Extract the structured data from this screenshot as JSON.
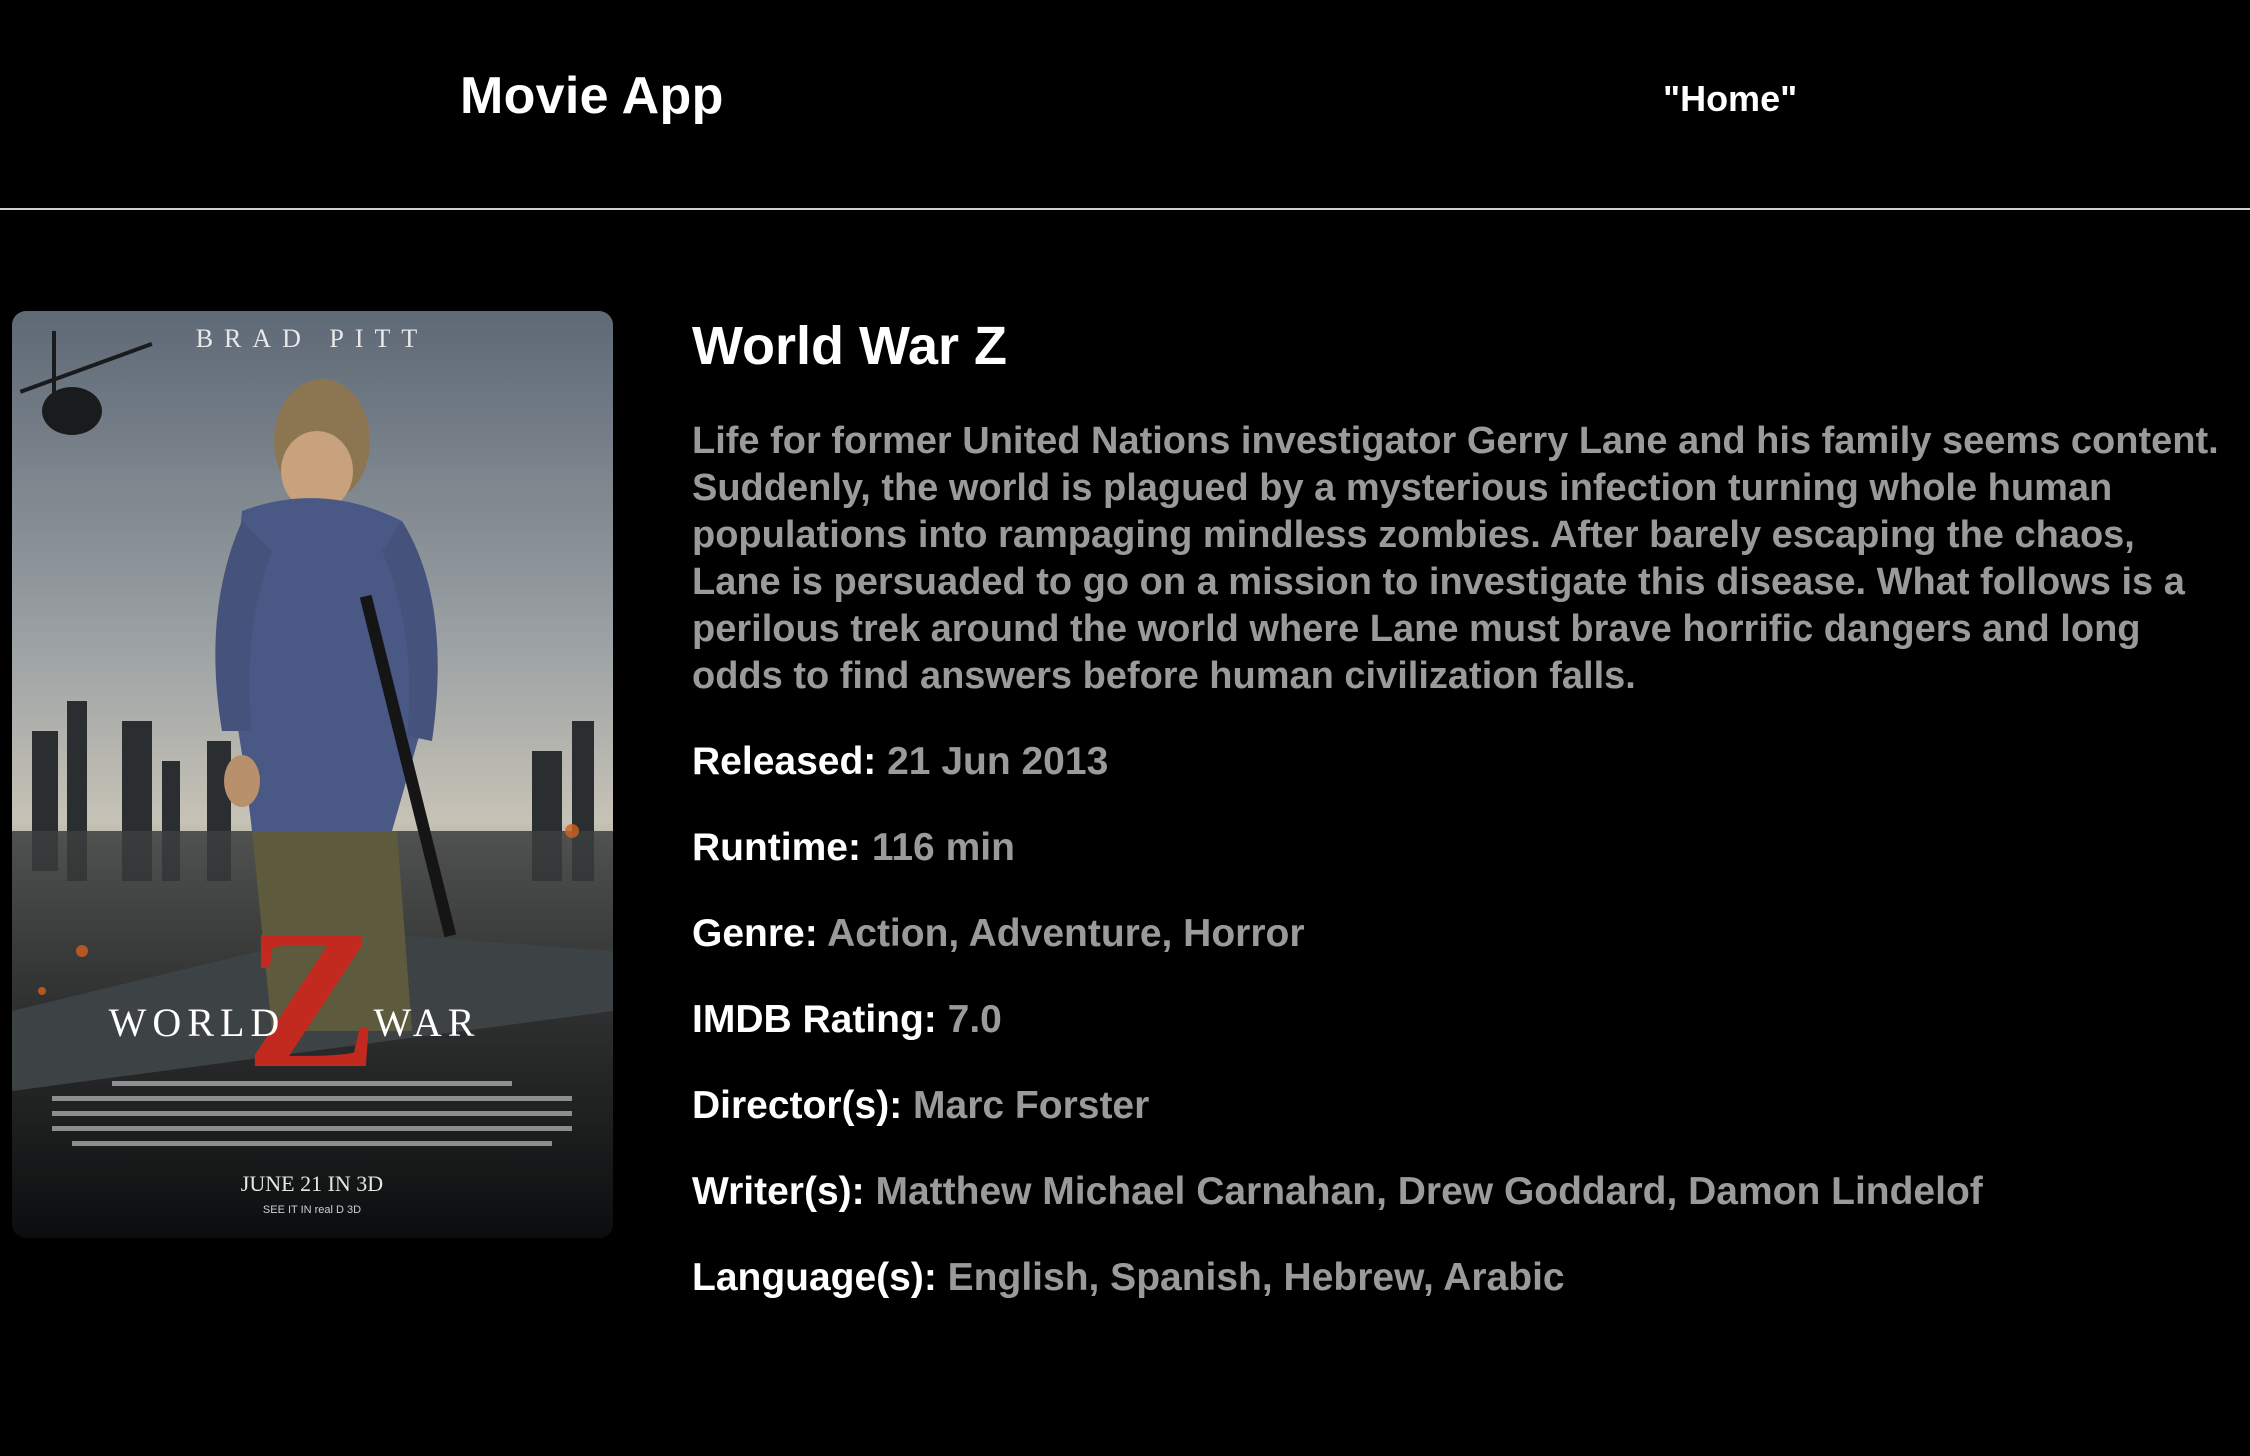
{
  "header": {
    "brand": "Movie App",
    "nav_home": "\"Home\""
  },
  "movie": {
    "title": "World War Z",
    "plot": "Life for former United Nations investigator Gerry Lane and his family seems content. Suddenly, the world is plagued by a mysterious infection turning whole human populations into rampaging mindless zombies. After barely escaping the chaos, Lane is persuaded to go on a mission to investigate this disease. What follows is a perilous trek around the world where Lane must brave horrific dangers and long odds to find answers before human civilization falls.",
    "fields": {
      "released": {
        "label": "Released:",
        "value": "21 Jun 2013"
      },
      "runtime": {
        "label": "Runtime:",
        "value": "116 min"
      },
      "genre": {
        "label": "Genre:",
        "value": "Action, Adventure, Horror"
      },
      "imdb": {
        "label": "IMDB Rating:",
        "value": "7.0"
      },
      "director": {
        "label": "Director(s):",
        "value": "Marc Forster"
      },
      "writer": {
        "label": "Writer(s):",
        "value": "Matthew Michael Carnahan, Drew Goddard, Damon Lindelof"
      },
      "language": {
        "label": "Language(s):",
        "value": "English, Spanish, Hebrew, Arabic"
      }
    }
  },
  "poster": {
    "actor": "BRAD PITT",
    "title_left": "WORLD",
    "title_right": "WAR",
    "title_z": "Z",
    "release_line": "JUNE 21 IN 3D",
    "see_line": "SEE IT IN real D 3D",
    "colors": {
      "sky_top": "#6f7a86",
      "sky_bottom": "#c9c6bd",
      "shirt": "#4a5886",
      "z_red": "#c2291f"
    }
  },
  "colors": {
    "background": "#000000",
    "text_primary": "#ffffff",
    "text_secondary": "#9a9a9a",
    "divider": "#cfcfcf"
  }
}
